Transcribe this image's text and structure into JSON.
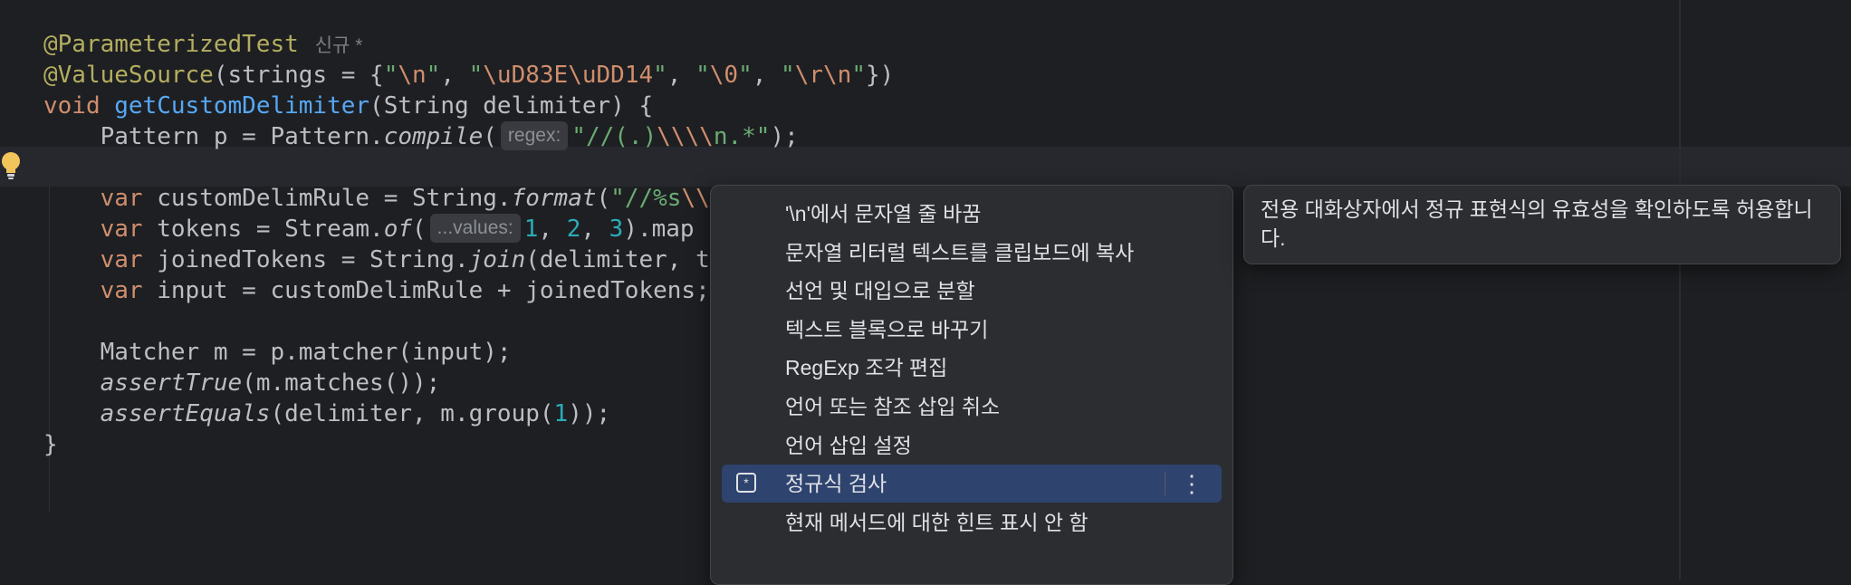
{
  "editor": {
    "lines": [
      {
        "parts": [
          {
            "t": "@ParameterizedTest",
            "c": "ann"
          }
        ],
        "tag": "신규 *"
      },
      {
        "parts": [
          {
            "t": "@ValueSource",
            "c": "ann"
          },
          {
            "t": "(strings = {"
          },
          {
            "t": "\"",
            "c": "str"
          },
          {
            "t": "\\n",
            "c": "esc"
          },
          {
            "t": "\"",
            "c": "str"
          },
          {
            "t": ", "
          },
          {
            "t": "\"",
            "c": "str"
          },
          {
            "t": "\\uD83E\\uDD14",
            "c": "esc"
          },
          {
            "t": "\"",
            "c": "str"
          },
          {
            "t": ", "
          },
          {
            "t": "\"",
            "c": "str"
          },
          {
            "t": "\\0",
            "c": "esc"
          },
          {
            "t": "\"",
            "c": "str"
          },
          {
            "t": ", "
          },
          {
            "t": "\"",
            "c": "str"
          },
          {
            "t": "\\r\\n",
            "c": "esc"
          },
          {
            "t": "\"",
            "c": "str"
          },
          {
            "t": "})"
          }
        ]
      },
      {
        "parts": [
          {
            "t": "void ",
            "c": "kw"
          },
          {
            "t": "getCustomDelimiter",
            "c": "fn"
          },
          {
            "t": "(String delimiter) {"
          }
        ]
      },
      {
        "parts": [
          {
            "t": "    Pattern p = Pattern."
          },
          {
            "t": "compile",
            "c": "it"
          },
          {
            "t": "("
          },
          {
            "t": "regex:",
            "c": "hint"
          },
          {
            "t": "\"//(.)",
            "c": "str"
          },
          {
            "t": "\\\\\\\\",
            "c": "esc"
          },
          {
            "t": "n.*\"",
            "c": "str"
          },
          {
            "t": ");"
          }
        ]
      },
      {
        "parts": []
      },
      {
        "parts": [
          {
            "t": "    "
          },
          {
            "t": "var ",
            "c": "kw"
          },
          {
            "t": "customDelimRule = String."
          },
          {
            "t": "format",
            "c": "it"
          },
          {
            "t": "("
          },
          {
            "t": "\"//%s",
            "c": "str"
          },
          {
            "t": "\\\\n",
            "c": "esc"
          }
        ]
      },
      {
        "parts": [
          {
            "t": "    "
          },
          {
            "t": "var ",
            "c": "kw"
          },
          {
            "t": "tokens = Stream."
          },
          {
            "t": "of",
            "c": "it"
          },
          {
            "t": "("
          },
          {
            "t": "...values:",
            "c": "hint"
          },
          {
            "t": "1",
            "c": "num"
          },
          {
            "t": ", "
          },
          {
            "t": "2",
            "c": "num"
          },
          {
            "t": ", "
          },
          {
            "t": "3",
            "c": "num"
          },
          {
            "t": ").map"
          }
        ]
      },
      {
        "parts": [
          {
            "t": "    "
          },
          {
            "t": "var ",
            "c": "kw"
          },
          {
            "t": "joinedTokens = String."
          },
          {
            "t": "join",
            "c": "it"
          },
          {
            "t": "(delimiter, to"
          }
        ]
      },
      {
        "parts": [
          {
            "t": "    "
          },
          {
            "t": "var ",
            "c": "kw"
          },
          {
            "t": "input = customDelimRule + joinedTokens;"
          }
        ]
      },
      {
        "parts": []
      },
      {
        "parts": [
          {
            "t": "    Matcher m = p.matcher(input);"
          }
        ]
      },
      {
        "parts": [
          {
            "t": "    "
          },
          {
            "t": "assertTrue",
            "c": "it"
          },
          {
            "t": "(m.matches());"
          }
        ]
      },
      {
        "parts": [
          {
            "t": "    "
          },
          {
            "t": "assertEquals",
            "c": "it"
          },
          {
            "t": "(delimiter, m.group("
          },
          {
            "t": "1",
            "c": "num"
          },
          {
            "t": "));"
          }
        ]
      },
      {
        "parts": [
          {
            "t": "}"
          }
        ]
      }
    ]
  },
  "menu": {
    "items": [
      {
        "label": "'\\n'에서 문자열 줄 바꿈"
      },
      {
        "label": "문자열 리터럴 텍스트를 클립보드에 복사"
      },
      {
        "label": "선언 및 대입으로 분할"
      },
      {
        "label": "텍스트 블록으로 바꾸기"
      },
      {
        "label": "RegExp 조각 편집"
      },
      {
        "label": "언어 또는 참조 삽입 취소"
      },
      {
        "label": "언어 삽입 설정"
      },
      {
        "label": "정규식 검사",
        "selected": true,
        "icon": "regex-icon"
      },
      {
        "label": "현재 메서드에 대한 힌트 표시 안 함"
      }
    ],
    "more_glyph": "⋮",
    "regex_icon_glyph": "*"
  },
  "tooltip": {
    "text": "전용 대화상자에서 정규 표현식의 유효성을 확인하도록 허용합니다."
  },
  "colors": {
    "background": "#1e1f22",
    "selection": "#2e436e",
    "annotation": "#b3ae60",
    "keyword": "#cf8e6d",
    "function": "#56a8f5",
    "string": "#6aab73",
    "number": "#2aacb8",
    "bulb": "#f2c55c"
  }
}
